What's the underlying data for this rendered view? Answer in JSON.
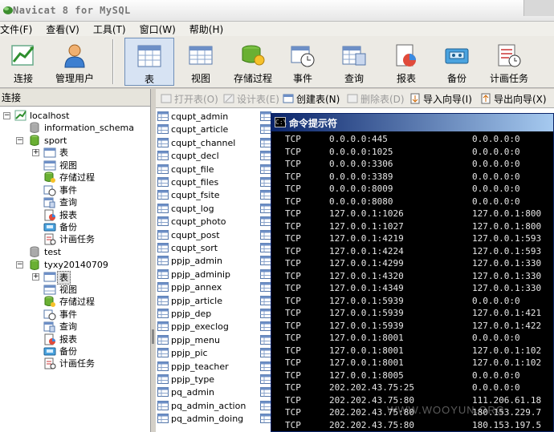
{
  "window": {
    "title": "Navicat 8 for MySQL"
  },
  "menu": [
    "文件(F)",
    "查看(V)",
    "工具(T)",
    "窗口(W)",
    "帮助(H)"
  ],
  "toolbar": {
    "connect": "连接",
    "manage_users": "管理用户",
    "table": "表",
    "view": "视图",
    "procedure": "存储过程",
    "event": "事件",
    "query": "查询",
    "report": "报表",
    "backup": "备份",
    "schedule": "计画任务"
  },
  "left_panel": {
    "header": "连接",
    "connection": "localhost",
    "databases": [
      {
        "name": "information_schema"
      },
      {
        "name": "sport"
      },
      {
        "name": "test"
      },
      {
        "name": "tyxy20140709"
      }
    ],
    "children": [
      "表",
      "视图",
      "存储过程",
      "事件",
      "查询",
      "报表",
      "备份",
      "计画任务"
    ]
  },
  "object_toolbar": {
    "open": "打开表(O)",
    "design": "设计表(E)",
    "create": "创建表(N)",
    "delete": "删除表(D)",
    "import": "导入向导(I)",
    "export": "导出向导(X)"
  },
  "tables": [
    "cqupt_admin",
    "cqupt_article",
    "cqupt_channel",
    "cqupt_decl",
    "cqupt_file",
    "cqupt_files",
    "cqupt_fsite",
    "cqupt_log",
    "cqupt_photo",
    "cqupt_post",
    "cqupt_sort",
    "ppjp_admin",
    "ppjp_adminip",
    "ppjp_annex",
    "ppjp_article",
    "ppjp_dep",
    "ppjp_execlog",
    "ppjp_menu",
    "ppjp_pic",
    "ppjp_teacher",
    "ppjp_type",
    "pq_admin",
    "pq_admin_action",
    "pq_admin_doing"
  ],
  "cmd": {
    "title": "命令提示符",
    "icon_text": "C:\\",
    "rows": [
      [
        "TCP",
        "0.0.0.0:445",
        "0.0.0.0:0"
      ],
      [
        "TCP",
        "0.0.0.0:1025",
        "0.0.0.0:0"
      ],
      [
        "TCP",
        "0.0.0.0:3306",
        "0.0.0.0:0"
      ],
      [
        "TCP",
        "0.0.0.0:3389",
        "0.0.0.0:0"
      ],
      [
        "TCP",
        "0.0.0.0:8009",
        "0.0.0.0:0"
      ],
      [
        "TCP",
        "0.0.0.0:8080",
        "0.0.0.0:0"
      ],
      [
        "TCP",
        "127.0.0.1:1026",
        "127.0.0.1:800"
      ],
      [
        "TCP",
        "127.0.0.1:1027",
        "127.0.0.1:800"
      ],
      [
        "TCP",
        "127.0.0.1:4219",
        "127.0.0.1:593"
      ],
      [
        "TCP",
        "127.0.0.1:4224",
        "127.0.0.1:593"
      ],
      [
        "TCP",
        "127.0.0.1:4299",
        "127.0.0.1:330"
      ],
      [
        "TCP",
        "127.0.0.1:4320",
        "127.0.0.1:330"
      ],
      [
        "TCP",
        "127.0.0.1:4349",
        "127.0.0.1:330"
      ],
      [
        "TCP",
        "127.0.0.1:5939",
        "0.0.0.0:0"
      ],
      [
        "TCP",
        "127.0.0.1:5939",
        "127.0.0.1:421"
      ],
      [
        "TCP",
        "127.0.0.1:5939",
        "127.0.0.1:422"
      ],
      [
        "TCP",
        "127.0.0.1:8001",
        "0.0.0.0:0"
      ],
      [
        "TCP",
        "127.0.0.1:8001",
        "127.0.0.1:102"
      ],
      [
        "TCP",
        "127.0.0.1:8001",
        "127.0.0.1:102"
      ],
      [
        "TCP",
        "127.0.0.1:8005",
        "0.0.0.0:0"
      ],
      [
        "TCP",
        "202.202.43.75:25",
        "0.0.0.0:0"
      ],
      [
        "TCP",
        "202.202.43.75:80",
        "111.206.61.18"
      ],
      [
        "TCP",
        "202.202.43.75:80",
        "180.153.229.7"
      ],
      [
        "TCP",
        "202.202.43.75:80",
        "180.153.197.5"
      ]
    ],
    "watermark": "WWW.WOOYUN.ORG"
  }
}
